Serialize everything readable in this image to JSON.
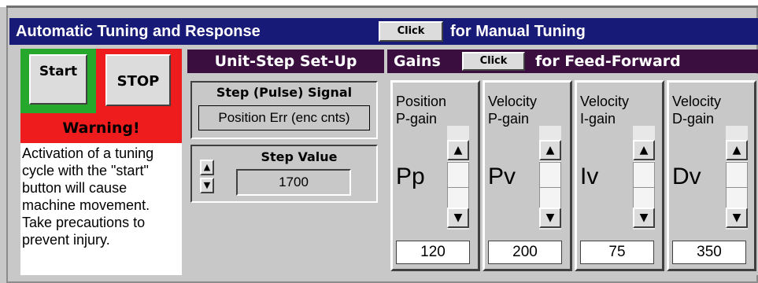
{
  "header": {
    "title": "Automatic Tuning and Response",
    "manual_click_label": "Click",
    "manual_text": "for Manual Tuning"
  },
  "controls": {
    "start_label": "Start",
    "stop_label": "STOP",
    "warning_title": "Warning!",
    "warning_message": "Activation of a tuning cycle with the \"start\" button will cause machine movement. Take precautions to prevent injury."
  },
  "unit_step": {
    "header": "Unit-Step Set-Up",
    "signal_title": "Step (Pulse) Signal",
    "signal_value": "Position Err (enc cnts)",
    "value_title": "Step Value",
    "value": "1700"
  },
  "gains": {
    "header": "Gains",
    "ff_click_label": "Click",
    "ff_text": "for Feed-Forward",
    "items": [
      {
        "label_line1": "Position",
        "label_line2": "P-gain",
        "symbol": "Pp",
        "value": "120"
      },
      {
        "label_line1": "Velocity",
        "label_line2": "P-gain",
        "symbol": "Pv",
        "value": "200"
      },
      {
        "label_line1": "Velocity",
        "label_line2": "I-gain",
        "symbol": "Iv",
        "value": "75"
      },
      {
        "label_line1": "Velocity",
        "label_line2": "D-gain",
        "symbol": "Dv",
        "value": "350"
      }
    ]
  },
  "colors": {
    "title_bar": "#181a78",
    "section_header": "#3a0f3f",
    "warning_red": "#ee1c1c",
    "start_green": "#26a82c",
    "panel_gray": "#c8c8c8"
  },
  "icons": {
    "up": "up-arrow-icon",
    "down": "down-arrow-icon"
  }
}
